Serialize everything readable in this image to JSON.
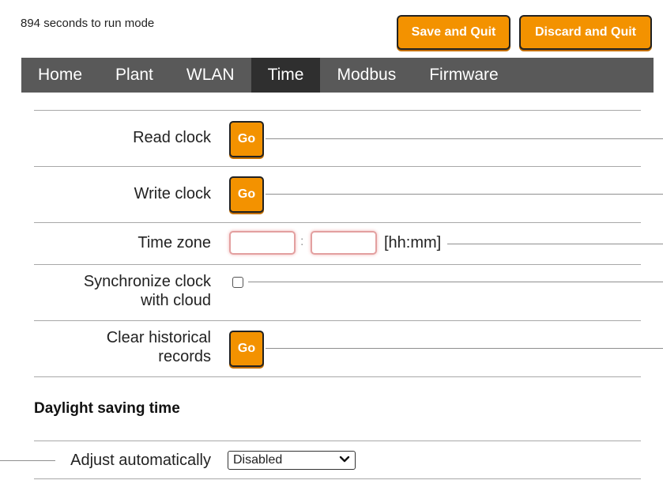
{
  "header": {
    "countdown_text": "894 seconds to run mode",
    "save_label": "Save and Quit",
    "discard_label": "Discard and Quit"
  },
  "nav": {
    "items": [
      "Home",
      "Plant",
      "WLAN",
      "Time",
      "Modbus",
      "Firmware"
    ],
    "active": "Time"
  },
  "rows": {
    "read_clock": {
      "label": "Read clock",
      "button": "Go"
    },
    "write_clock": {
      "label": "Write clock",
      "button": "Go"
    },
    "time_zone": {
      "label": "Time zone",
      "hours_value": "",
      "minutes_value": "",
      "separator": ":",
      "unit": "[hh:mm]"
    },
    "sync_cloud": {
      "label_line1": "Synchronize clock",
      "label_line2": "with cloud",
      "checked": false
    },
    "clear_history": {
      "label_line1": "Clear historical",
      "label_line2": "records",
      "button": "Go"
    }
  },
  "dst": {
    "section_title": "Daylight saving time",
    "adjust_label": "Adjust automatically",
    "adjust_value": "Disabled"
  },
  "colors": {
    "accent": "#f39200",
    "nav_bg": "#595959",
    "nav_active": "#2f2f2f"
  }
}
